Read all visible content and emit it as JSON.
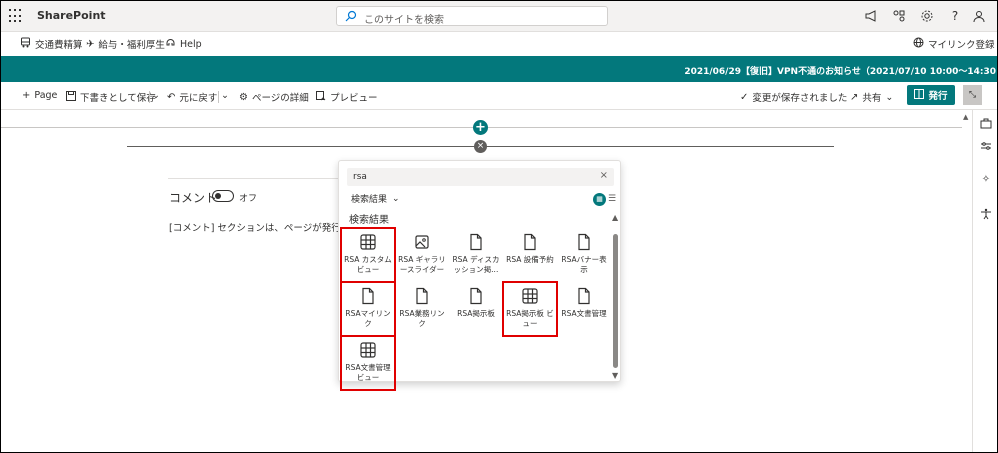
{
  "suite": {
    "brand": "SharePoint",
    "search_placeholder": "このサイトを検索"
  },
  "nav": {
    "items": [
      {
        "label": "交通費精算",
        "icon": "bus-icon"
      },
      {
        "label": "給与・福利厚生",
        "icon": "airplane-icon"
      },
      {
        "label": "Help",
        "icon": "help-icon"
      }
    ],
    "right_link": "マイリンク登録"
  },
  "banner": {
    "message": "2021/06/29【復旧】VPN不通のお知らせ（2021/07/10 10:00～14:30"
  },
  "commands": {
    "page": "Page",
    "save_draft": "下書きとして保存",
    "undo": "元に戻す",
    "page_details": "ページの詳細",
    "preview": "プレビュー",
    "saved_status": "変更が保存されました",
    "share": "共有",
    "publish": "発行"
  },
  "comments": {
    "title": "コメント",
    "toggle_state": "オフ",
    "note": "[コメント] セクションは、ページが発行された"
  },
  "toolbox": {
    "search_value": "rsa",
    "filter_label": "検索結果",
    "heading": "検索結果",
    "tiles": [
      {
        "label": "RSA カスタムビュー",
        "icon": "table-icon",
        "highlighted": true
      },
      {
        "label": "RSA ギャラリースライダー",
        "icon": "image-icon",
        "highlighted": false
      },
      {
        "label": "RSA ディスカッション掲...",
        "icon": "document-icon",
        "highlighted": false
      },
      {
        "label": "RSA 設備予約",
        "icon": "document-icon",
        "highlighted": false
      },
      {
        "label": "RSAバナー表示",
        "icon": "document-icon",
        "highlighted": false
      },
      {
        "label": "RSAマイリンク",
        "icon": "document-icon",
        "highlighted": true
      },
      {
        "label": "RSA業務リンク",
        "icon": "document-icon",
        "highlighted": false
      },
      {
        "label": "RSA掲示板",
        "icon": "document-icon",
        "highlighted": false
      },
      {
        "label": "RSA掲示板 ビュー",
        "icon": "table-icon",
        "highlighted": true
      },
      {
        "label": "RSA文書管理",
        "icon": "document-icon",
        "highlighted": false
      },
      {
        "label": "RSA文書管理ビュー",
        "icon": "table-icon",
        "highlighted": true
      }
    ]
  },
  "colors": {
    "accent": "#03787c",
    "highlight": "#e00000"
  }
}
